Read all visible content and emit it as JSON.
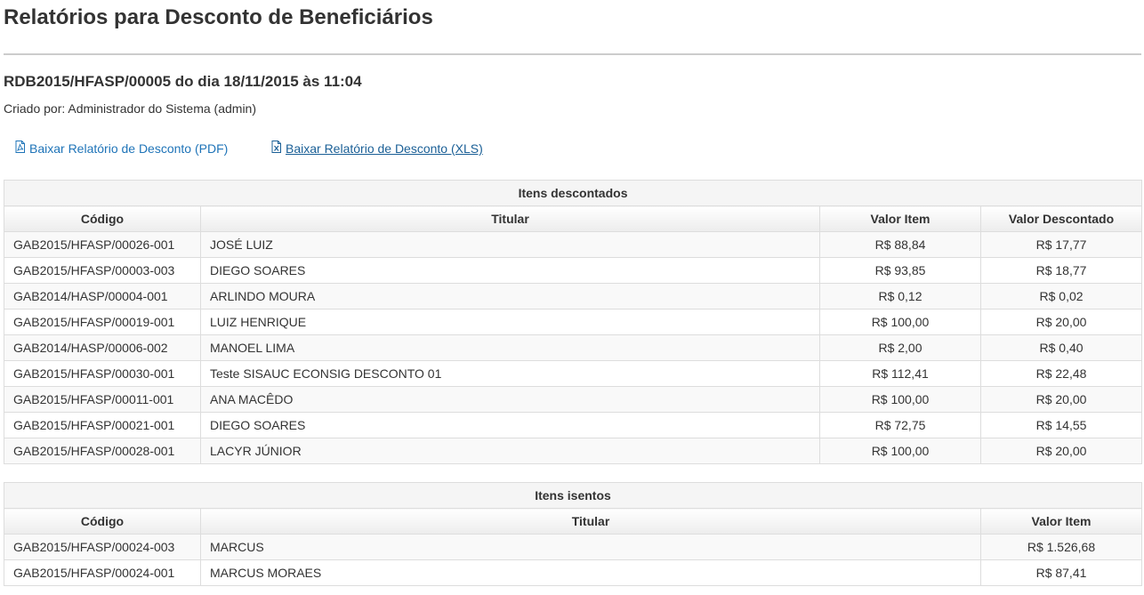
{
  "page": {
    "title": "Relatórios para Desconto de Beneficiários",
    "report_title": "RDB2015/HFASP/00005 do dia 18/11/2015 às 11:04",
    "created_by": "Criado por: Administrador do Sistema (admin)"
  },
  "links": {
    "pdf_label": "Baixar Relatório de Desconto (PDF)",
    "pdf_icon": "pdf-file-icon",
    "xls_label": "Baixar Relatório de Desconto (XLS)",
    "xls_icon": "excel-file-icon"
  },
  "discounted": {
    "caption": "Itens descontados",
    "headers": [
      "Código",
      "Titular",
      "Valor Item",
      "Valor Descontado"
    ],
    "rows": [
      [
        "GAB2015/HFASP/00026-001",
        "JOSÉ LUIZ",
        "R$ 88,84",
        "R$ 17,77"
      ],
      [
        "GAB2015/HFASP/00003-003",
        "DIEGO SOARES",
        "R$ 93,85",
        "R$ 18,77"
      ],
      [
        "GAB2014/HASP/00004-001",
        "ARLINDO MOURA",
        "R$ 0,12",
        "R$ 0,02"
      ],
      [
        "GAB2015/HFASP/00019-001",
        "LUIZ HENRIQUE",
        "R$ 100,00",
        "R$ 20,00"
      ],
      [
        "GAB2014/HASP/00006-002",
        "MANOEL LIMA",
        "R$ 2,00",
        "R$ 0,40"
      ],
      [
        "GAB2015/HFASP/00030-001",
        "Teste SISAUC ECONSIG DESCONTO 01",
        "R$ 112,41",
        "R$ 22,48"
      ],
      [
        "GAB2015/HFASP/00011-001",
        "ANA MACÊDO",
        "R$ 100,00",
        "R$ 20,00"
      ],
      [
        "GAB2015/HFASP/00021-001",
        "DIEGO SOARES",
        "R$ 72,75",
        "R$ 14,55"
      ],
      [
        "GAB2015/HFASP/00028-001",
        "LACYR JÚNIOR",
        "R$ 100,00",
        "R$ 20,00"
      ]
    ]
  },
  "exempt": {
    "caption": "Itens isentos",
    "headers": [
      "Código",
      "Titular",
      "Valor Item"
    ],
    "rows": [
      [
        "GAB2015/HFASP/00024-003",
        "MARCUS",
        "R$ 1.526,68"
      ],
      [
        "GAB2015/HFASP/00024-001",
        "MARCUS MORAES",
        "R$ 87,41"
      ]
    ]
  },
  "colors": {
    "link": "#1f74b8",
    "border": "#dddddd",
    "caption_bg": "#f5f5f5",
    "stripe_bg": "#f9f9f9"
  }
}
